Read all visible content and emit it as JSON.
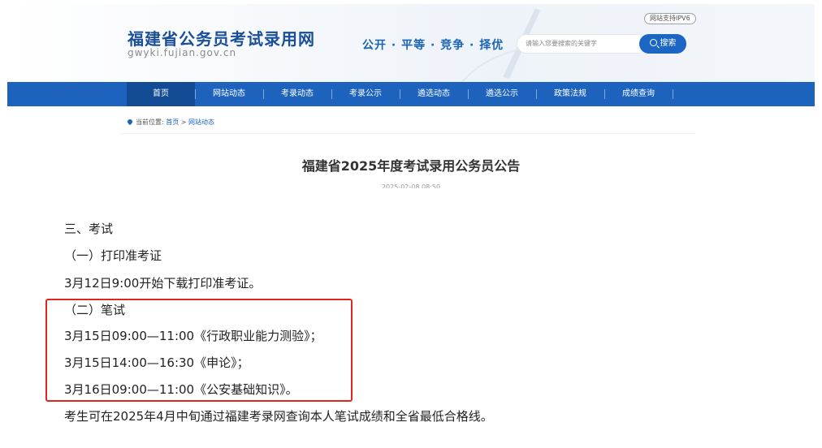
{
  "header": {
    "site_title": "福建省公务员考试录用网",
    "site_domain": "gwyki.fujian.gov.cn",
    "slogan": "公开 · 平等 · 竞争 · 择优",
    "ipv6_badge": "网站支持IPV6",
    "search": {
      "placeholder": "请输入您要搜索的关键字",
      "button_label": "搜索",
      "icon": "search-icon"
    }
  },
  "nav": {
    "items": [
      {
        "label": "首页",
        "active": true
      },
      {
        "label": "网站动态",
        "active": false
      },
      {
        "label": "考录动态",
        "active": false
      },
      {
        "label": "考录公示",
        "active": false
      },
      {
        "label": "遴选动态",
        "active": false
      },
      {
        "label": "遴选公示",
        "active": false
      },
      {
        "label": "政策法规",
        "active": false
      },
      {
        "label": "成绩查询",
        "active": false
      }
    ]
  },
  "breadcrumb": {
    "prefix": "当前位置:",
    "home": "首页",
    "separator": ">",
    "current": "网站动态"
  },
  "article": {
    "title": "福建省2025年度考试录用公务员公告",
    "date": "2025-02-08 08:50",
    "lines": [
      "三、考试",
      "（一）打印准考证",
      "3月12日9:00开始下载打印准考证。",
      "（二）笔试",
      "3月15日09:00—11:00《行政职业能力测验》；",
      "3月15日14:00—16:30《申论》；",
      "3月16日09:00—11:00《公安基础知识》。",
      "考生可在2025年4月中旬通过福建考录网查询本人笔试成绩和全省最低合格线。"
    ]
  },
  "colors": {
    "brand_blue": "#1d63bd",
    "nav_active": "#134c95",
    "highlight_red": "#e0261f"
  }
}
